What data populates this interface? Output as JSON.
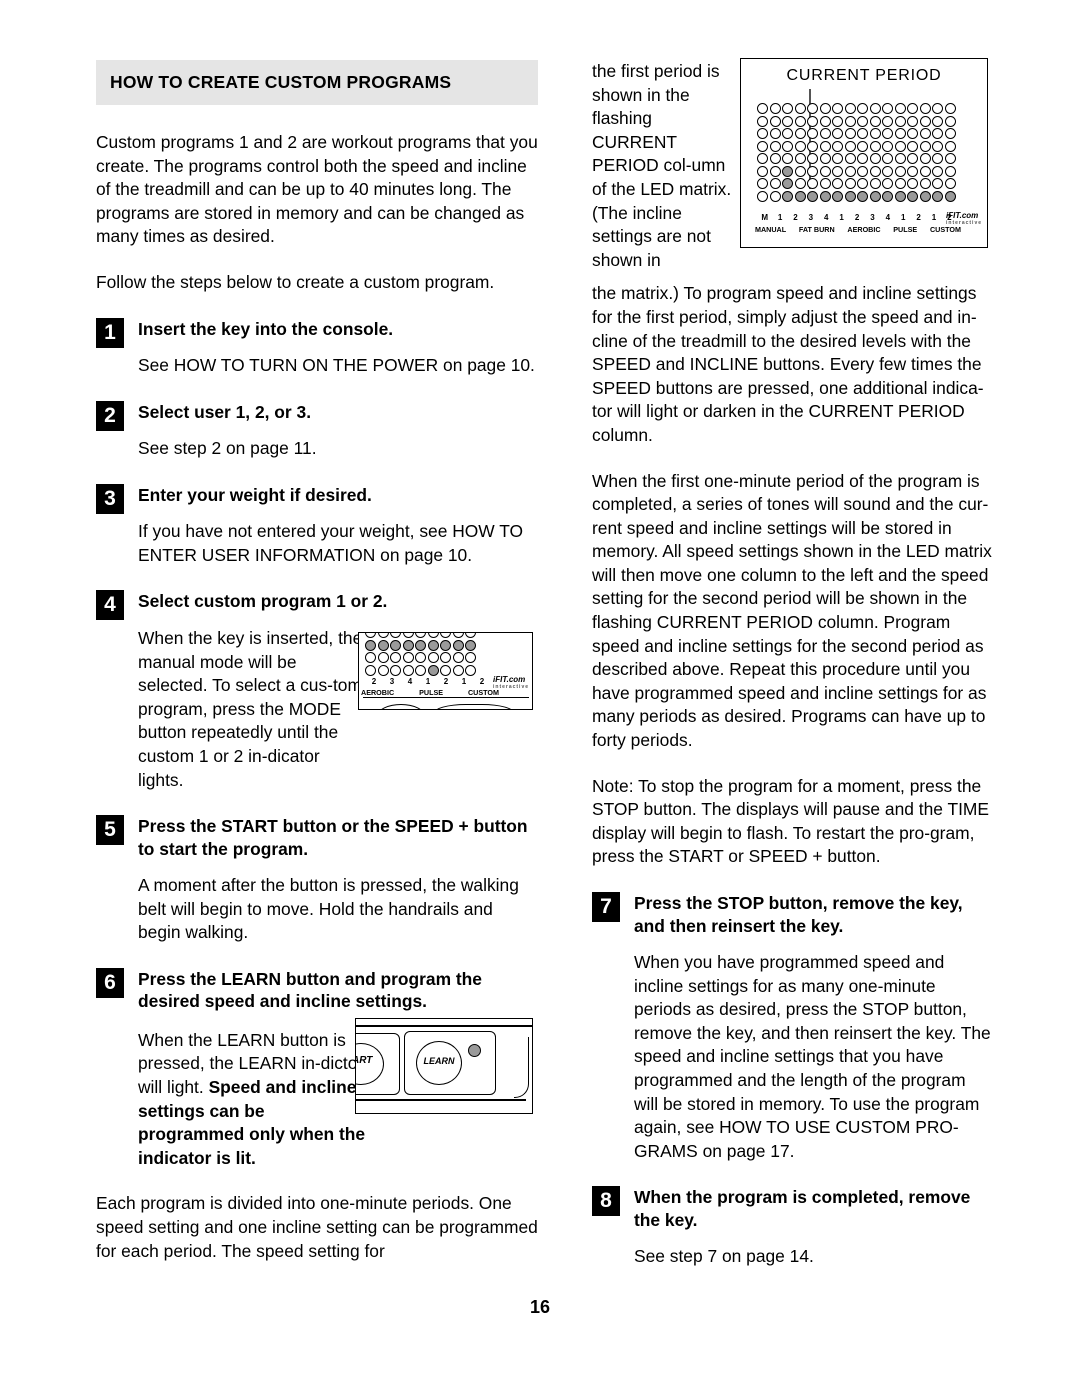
{
  "page": {
    "number": "16",
    "section_title": "HOW TO CREATE CUSTOM PROGRAMS"
  },
  "left_column": {
    "intro_paragraph": "Custom programs 1 and 2 are workout programs that you create. The programs control both the speed and incline of the treadmill and can be up to 40 minutes long. The programs are stored in memory and can be changed as many times as desired.",
    "follow_paragraph": "Follow the steps below to create a custom program.",
    "steps": [
      {
        "number": "1",
        "title": "Insert the key into the console.",
        "body": "See HOW TO TURN ON THE POWER on page 10."
      },
      {
        "number": "2",
        "title": "Select user 1, 2, or 3.",
        "body": "See step 2 on page 11."
      },
      {
        "number": "3",
        "title": "Enter your weight if desired.",
        "body": "If you have not entered your weight, see HOW TO ENTER USER INFORMATION on page 10."
      },
      {
        "number": "4",
        "title": "Select custom program 1 or 2.",
        "body": "When the key is inserted, the manual mode will be selected. To select a cus-tom program, press the MODE button repeatedly until the custom 1 or 2 in-dicator lights."
      },
      {
        "number": "5",
        "title": "Press the START button or the SPEED + button to start the program.",
        "body": "A moment after the button is pressed, the walking belt will begin to move. Hold the handrails and begin walking."
      },
      {
        "number": "6",
        "title": "Press the LEARN button and program the desired speed and incline settings.",
        "body_plain": "When the LEARN button is pressed, the LEARN in-dictor will light. ",
        "body_bold": "Speed and incline settings can be programmed only when the indicator is lit."
      }
    ],
    "closing_paragraph": "Each program is divided into one-minute periods. One speed setting and one incline setting can be programmed for each period. The speed setting for"
  },
  "right_column": {
    "wrap_paragraph": "the first period is shown in the flashing CURRENT PERIOD col-umn of the LED matrix. (The incline settings are not shown in",
    "continue_paragraph": "the matrix.) To program speed and incline settings for the first period, simply adjust the speed and in-cline of the treadmill to the desired levels with the SPEED and INCLINE buttons. Every few times the SPEED buttons are pressed, one additional indica-tor will light or darken in the CURRENT PERIOD column.",
    "period_paragraph": "When the first one-minute period of the program is completed, a series of tones will sound and the cur-rent speed and incline settings will be stored in memory. All speed settings shown in the LED matrix will then move one column to the left and the speed setting for the second period will be shown in the flashing CURRENT PERIOD column. Program speed and incline settings for the second period as described above. Repeat this procedure until you have programmed speed and incline settings for as many periods as desired. Programs can have up to forty periods.",
    "note_paragraph": "Note: To stop the program for a moment, press the STOP button. The displays will pause and the TIME display will begin to flash. To restart the pro-gram, press the START or SPEED + button.",
    "steps": [
      {
        "number": "7",
        "title": "Press the STOP button, remove the key, and then reinsert the key.",
        "body": "When you have programmed speed and incline settings for as many one-minute periods as desired, press the STOP button, remove the key, and then reinsert the key. The speed and incline settings that you have programmed and the length of the program will be stored in memory. To use the program again, see HOW TO USE CUSTOM PRO-GRAMS on page 17."
      },
      {
        "number": "8",
        "title": "When the program is completed, remove the key.",
        "body": "See step 7 on page 14."
      }
    ]
  },
  "figures": {
    "current_period": {
      "caption": "CURRENT PERIOD",
      "rows": 8,
      "columns": 16,
      "column_labels": [
        "M",
        "1",
        "2",
        "3",
        "4",
        "1",
        "2",
        "3",
        "4",
        "1",
        "2",
        "1",
        "2"
      ],
      "group_labels": [
        "MANUAL",
        "FAT BURN",
        "AEROBIC",
        "PULSE",
        "CUSTOM"
      ],
      "brand": "iFIT.com",
      "brand_sub": "interactive",
      "pointer_column": 3
    },
    "console_mode": {
      "column_labels": [
        "2",
        "3",
        "4",
        "1",
        "2",
        "1",
        "2"
      ],
      "group_labels": [
        "AEROBIC",
        "PULSE",
        "CUSTOM"
      ],
      "brand": "iFIT.com",
      "brand_sub": "interactive"
    },
    "learn_panel": {
      "start_button_label": "ART",
      "learn_button_label": "LEARN"
    }
  },
  "colors": {
    "header_band": "#e5e5e5",
    "led_on": "#9a9a9a",
    "ink": "#000000",
    "paper": "#ffffff"
  }
}
